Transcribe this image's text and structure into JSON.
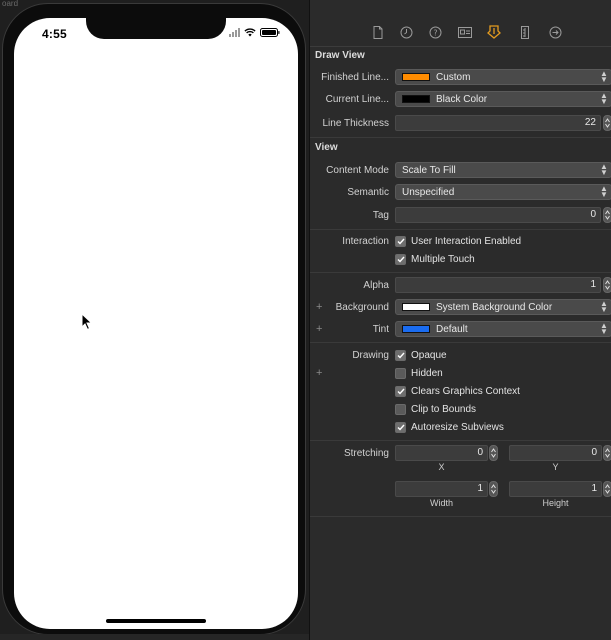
{
  "canvas": {
    "top_fragment": "oard",
    "phone": {
      "time": "4:55"
    }
  },
  "inspector": {
    "toolbar_icons": [
      "file-icon",
      "history-icon",
      "help-icon",
      "identity-icon",
      "attributes-icon",
      "size-icon",
      "connections-icon"
    ],
    "draw_view": {
      "title": "Draw View",
      "finished_line": {
        "label": "Finished Line...",
        "value": "Custom",
        "color": "#ff8c00"
      },
      "current_line": {
        "label": "Current Line...",
        "value": "Black Color",
        "color": "#000000"
      },
      "line_thickness": {
        "label": "Line Thickness",
        "value": "22"
      }
    },
    "view": {
      "title": "View",
      "content_mode": {
        "label": "Content Mode",
        "value": "Scale To Fill"
      },
      "semantic": {
        "label": "Semantic",
        "value": "Unspecified"
      },
      "tag": {
        "label": "Tag",
        "value": "0"
      },
      "interaction": {
        "label": "Interaction",
        "options": [
          {
            "label": "User Interaction Enabled",
            "checked": true
          },
          {
            "label": "Multiple Touch",
            "checked": true
          }
        ]
      },
      "alpha": {
        "label": "Alpha",
        "value": "1"
      },
      "background": {
        "label": "Background",
        "value": "System Background Color",
        "color": "#ffffff"
      },
      "tint": {
        "label": "Tint",
        "value": "Default",
        "color": "#1a6cf0"
      },
      "drawing": {
        "label": "Drawing",
        "options": [
          {
            "label": "Opaque",
            "checked": true
          },
          {
            "label": "Hidden",
            "checked": false
          },
          {
            "label": "Clears Graphics Context",
            "checked": true
          },
          {
            "label": "Clip to Bounds",
            "checked": false
          },
          {
            "label": "Autoresize Subviews",
            "checked": true
          }
        ]
      },
      "stretching": {
        "label": "Stretching",
        "x": "0",
        "y": "0",
        "width": "1",
        "height": "1",
        "x_label": "X",
        "y_label": "Y",
        "width_label": "Width",
        "height_label": "Height"
      }
    }
  }
}
